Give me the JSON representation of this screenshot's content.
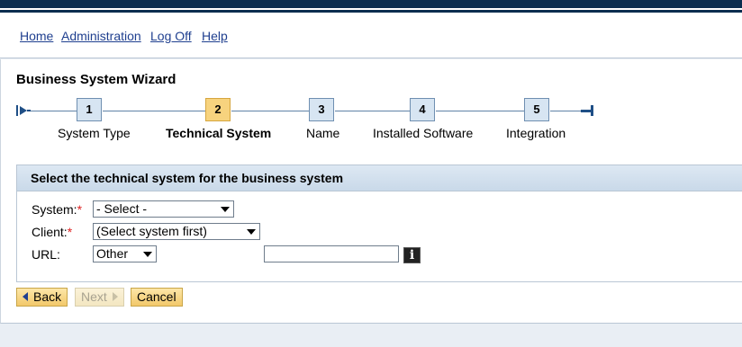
{
  "nav": {
    "links": [
      "Home",
      "Administration",
      "Log Off",
      "Help"
    ]
  },
  "wizard": {
    "title": "Business System Wizard",
    "steps": [
      {
        "number": "1",
        "label": "System Type",
        "active": false
      },
      {
        "number": "2",
        "label": "Technical System",
        "active": true
      },
      {
        "number": "3",
        "label": "Name",
        "active": false
      },
      {
        "number": "4",
        "label": "Installed Software",
        "active": false
      },
      {
        "number": "5",
        "label": "Integration",
        "active": false
      }
    ]
  },
  "form": {
    "heading": "Select the technical system for the business system",
    "system_label": "System:",
    "system_value": "- Select -",
    "client_label": "Client:",
    "client_value": "(Select system first)",
    "url_label": "URL:",
    "url_type_value": "Other",
    "url_value": "",
    "required_mark": "*",
    "info_icon": "i"
  },
  "buttons": {
    "back": "Back",
    "next": "Next",
    "cancel": "Cancel"
  },
  "colors": {
    "header_dark": "#0b2d4f",
    "link": "#1f3f8f",
    "active_step": "#f7d37e",
    "step": "#d7e5f2",
    "button": "#f2c86a"
  }
}
